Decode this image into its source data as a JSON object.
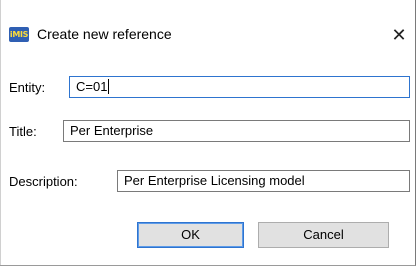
{
  "window": {
    "icon": "imis-app-icon",
    "icon_text": "iMIS",
    "title": "Create new reference",
    "close_glyph": "✕"
  },
  "form": {
    "entity": {
      "label": "Entity:",
      "value": "C=01"
    },
    "title": {
      "label": "Title:",
      "value": "Per Enterprise"
    },
    "description": {
      "label": "Description:",
      "value": "Per Enterprise Licensing model"
    }
  },
  "buttons": {
    "ok": "OK",
    "cancel": "Cancel"
  },
  "colors": {
    "focus_border": "#2e74cf",
    "field_border": "#7a7a7a",
    "button_face": "#e1e1e1"
  }
}
